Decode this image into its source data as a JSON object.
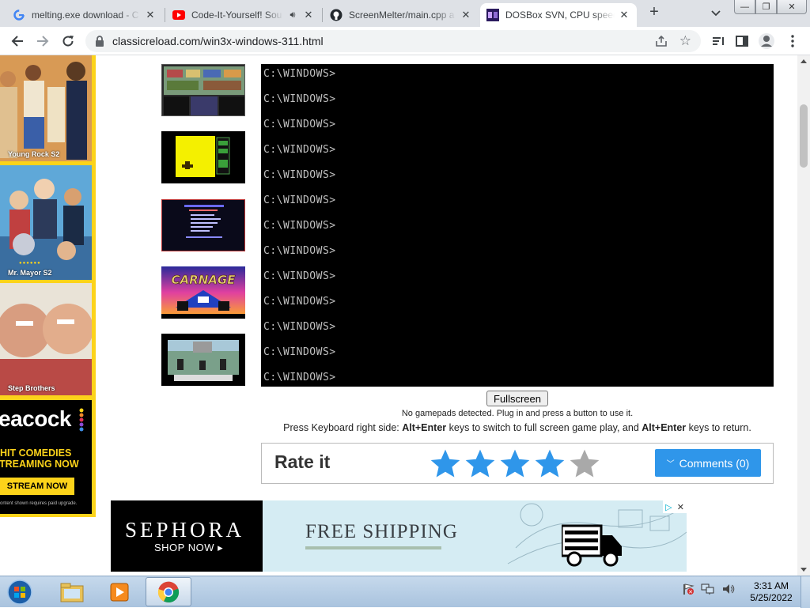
{
  "browser": {
    "tabs": [
      {
        "title": "melting.exe download - C",
        "icon": "google-icon",
        "active": false
      },
      {
        "title": "Code-It-Yourself! Sou",
        "icon": "youtube-icon",
        "active": false
      },
      {
        "title": "ScreenMelter/main.cpp a",
        "icon": "github-icon",
        "active": false
      },
      {
        "title": "DOSBox SVN, CPU speed:",
        "icon": "dosbox-icon",
        "active": true
      }
    ],
    "url": "classicreload.com/win3x-windows-311.html"
  },
  "left_ad": {
    "panels": [
      {
        "caption": "Young Rock S2"
      },
      {
        "caption": "Mr. Mayor S2"
      },
      {
        "caption": "Step Brothers"
      }
    ],
    "brand": "eacock",
    "line1": "HIT COMEDIES",
    "line2": "TREAMING NOW",
    "cta": "STREAM NOW",
    "fineprint": "ontent shown requires paid upgrade."
  },
  "emulator": {
    "prompt_lines": [
      "C:\\WINDOWS>",
      "C:\\WINDOWS>",
      "C:\\WINDOWS>",
      "C:\\WINDOWS>",
      "C:\\WINDOWS>",
      "C:\\WINDOWS>",
      "C:\\WINDOWS>",
      "C:\\WINDOWS>",
      "C:\\WINDOWS>",
      "C:\\WINDOWS>",
      "C:\\WINDOWS>",
      "C:\\WINDOWS>",
      "C:\\WINDOWS>"
    ],
    "fullscreen_label": "Fullscreen",
    "gamepad_note": "No gamepads detected. Plug in and press a button to use it.",
    "kb_note_pre": "Press Keyboard right side: ",
    "kb_key1": "Alt+Enter",
    "kb_note_mid": " keys to switch to full screen game play, and ",
    "kb_key2": "Alt+Enter",
    "kb_note_post": " keys to return."
  },
  "rating": {
    "title": "Rate it",
    "stars_filled": 4,
    "stars_total": 5,
    "comments_label": "Comments (0)",
    "star_color": "#2f96ea",
    "star_empty_color": "#a9a9a9"
  },
  "banner_ad": {
    "brand": "SEPHORA",
    "cta": "SHOP NOW ▸",
    "headline": "FREE SHIPPING"
  },
  "taskbar": {
    "time": "3:31 AM",
    "date": "5/25/2022"
  }
}
